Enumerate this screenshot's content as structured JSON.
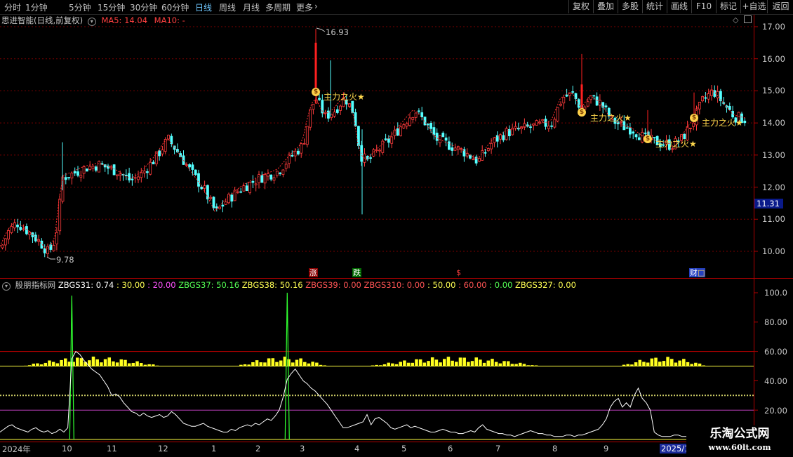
{
  "toolbar": {
    "periods": [
      "分时",
      "1分钟",
      "5分钟",
      "15分钟",
      "30分钟",
      "60分钟",
      "日线",
      "周线",
      "月线",
      "多周期",
      "更多"
    ],
    "active_period": "日线",
    "more_arrow": "›",
    "right_buttons": [
      "复权",
      "叠加",
      "多股",
      "统计",
      "画线",
      "F10",
      "标记",
      "+自选",
      "返回"
    ]
  },
  "price_panel": {
    "stock_name": "思进智能(日线,前复权)",
    "ma5": "MA5: 14.04",
    "ma10": "MA10: -",
    "y_ticks": [
      "17.00",
      "16.00",
      "15.00",
      "14.00",
      "13.00",
      "12.00",
      "11.00",
      "10.00"
    ],
    "high_label": "16.93",
    "low_label": "9.78",
    "current_price": "11.31",
    "signal_label": "主力之火",
    "star": "★",
    "money_glyph": "$",
    "markers": {
      "zhang": "涨",
      "die": "跌",
      "dollar": "$",
      "caibao": "财",
      "caibao_box": "□"
    }
  },
  "indicator_panel": {
    "name": "股朋指标网",
    "values": [
      {
        "text": "ZBGS31: 0.74",
        "color": "#ffffff"
      },
      {
        "text": ": 30.00",
        "color": "#ffff54"
      },
      {
        "text": ": 20.00",
        "color": "#ff54ff"
      },
      {
        "text": "ZBGS37: 50.16",
        "color": "#54ff54"
      },
      {
        "text": "ZBGS38: 50.16",
        "color": "#ffff54"
      },
      {
        "text": "ZBGS39: 0.00",
        "color": "#ff5454"
      },
      {
        "text": "ZBGS310: 0.00",
        "color": "#ff5454"
      },
      {
        "text": ": 50.00",
        "color": "#ffff54"
      },
      {
        "text": ": 60.00",
        "color": "#ff5454"
      },
      {
        "text": ": 0.00",
        "color": "#54ff54"
      },
      {
        "text": "ZBGS327: 0.00",
        "color": "#ffff54"
      }
    ],
    "y_ticks": [
      "100.0",
      "80.00",
      "60.00",
      "40.00",
      "20.00"
    ]
  },
  "date_axis": {
    "labels": [
      "2024年",
      "10",
      "11",
      "12",
      "1",
      "2",
      "3",
      "4",
      "5",
      "6",
      "7",
      "8",
      "9",
      "2025/1"
    ]
  },
  "watermark": {
    "title": "乐淘公式网",
    "url": "www.60lt.com"
  },
  "chart_data": {
    "type": "candlestick",
    "price_axis_range": [
      9.5,
      17.2
    ],
    "price_high": 16.93,
    "price_low": 9.78,
    "indicator_axis_range": [
      0,
      105
    ],
    "indicator_lines": [
      {
        "value": 60,
        "color": "#d00000"
      },
      {
        "value": 50,
        "color": "#ffff40"
      },
      {
        "value": 30,
        "color": "#cccc66",
        "style": "dotted"
      },
      {
        "value": 20,
        "color": "#c040c0"
      }
    ],
    "white_line": [
      5,
      7,
      9,
      10,
      8,
      7,
      6,
      5,
      7,
      8,
      6,
      5,
      6,
      4,
      5,
      7,
      5,
      8,
      55,
      60,
      58,
      54,
      51,
      48,
      46,
      44,
      40,
      36,
      30,
      31,
      29,
      25,
      22,
      19,
      18,
      16,
      18,
      16,
      15,
      16,
      17,
      15,
      16,
      19,
      17,
      14,
      11,
      10,
      9,
      9,
      10,
      11,
      9,
      8,
      7,
      6,
      5,
      5,
      7,
      6,
      8,
      9,
      10,
      9,
      11,
      10,
      12,
      14,
      13,
      16,
      20,
      29,
      41,
      45,
      48,
      44,
      40,
      38,
      35,
      33,
      30,
      27,
      24,
      20,
      16,
      12,
      8,
      8,
      9,
      10,
      11,
      12,
      17,
      10,
      14,
      15,
      13,
      11,
      8,
      7,
      8,
      9,
      10,
      8,
      9,
      8,
      7,
      6,
      5,
      5,
      6,
      7,
      6,
      5,
      5,
      4,
      4,
      5,
      6,
      5,
      8,
      10,
      7,
      6,
      5,
      4,
      4,
      3,
      3,
      2,
      3,
      4,
      5,
      6,
      5,
      4,
      4,
      3,
      3,
      2,
      2,
      2,
      3,
      3,
      2,
      3,
      3,
      4,
      5,
      6,
      7,
      10,
      14,
      22,
      26,
      28,
      22,
      25,
      22,
      30,
      35,
      28,
      25,
      20,
      5,
      3,
      2,
      2,
      2,
      3,
      3,
      2,
      2,
      2,
      2,
      2,
      2,
      3,
      3,
      2,
      2,
      2,
      2,
      2,
      1,
      1,
      1
    ],
    "green_spikes": [
      {
        "index": 18,
        "value": 98
      },
      {
        "index": 72,
        "value": 100
      }
    ],
    "yellow_bar_ranges": [
      [
        5,
        40
      ],
      [
        59,
        82
      ],
      [
        92,
        135
      ],
      [
        155,
        177
      ]
    ],
    "yellow_bar_peak": 56.5
  }
}
